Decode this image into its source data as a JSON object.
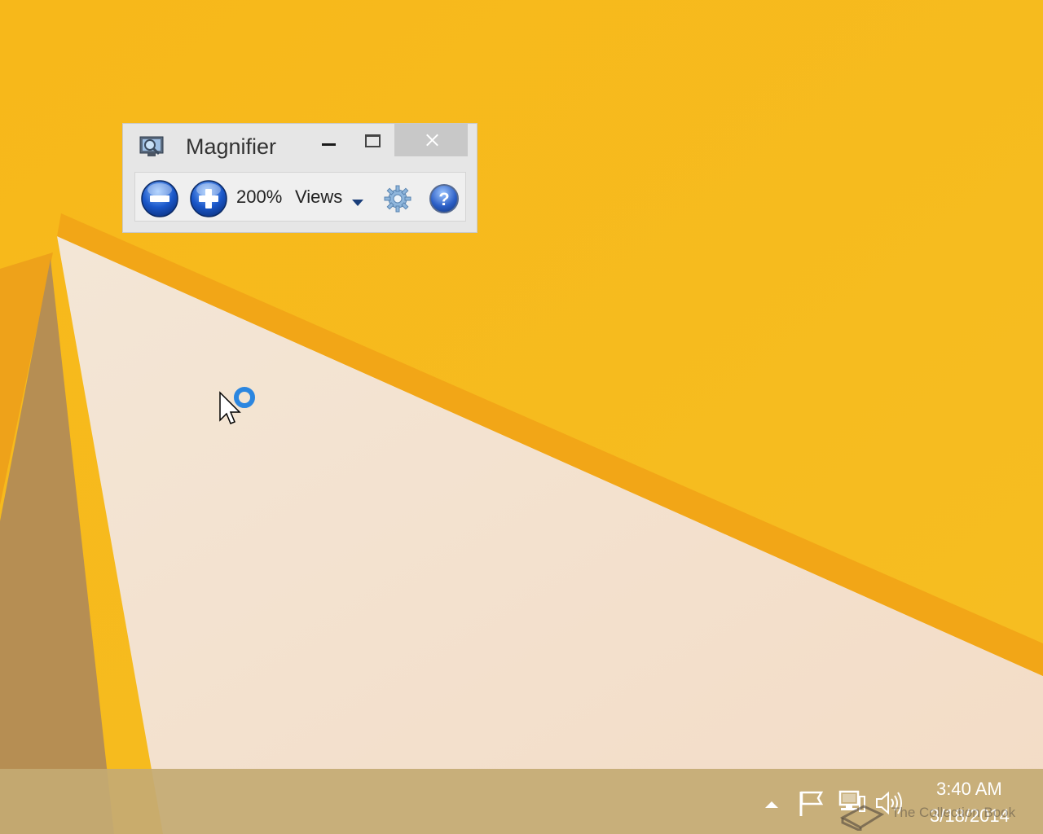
{
  "magnifier": {
    "title": "Magnifier",
    "zoom_level": "200%",
    "views_label": "Views",
    "icons": {
      "app": "magnifier-app-icon",
      "minimize": "minimize-icon",
      "maximize": "maximize-icon",
      "close": "close-icon",
      "zoom_out": "zoom-out-icon",
      "zoom_in": "zoom-in-icon",
      "views_dropdown": "chevron-down-icon",
      "options": "gear-icon",
      "help": "help-icon"
    }
  },
  "taskbar": {
    "time": "3:40 AM",
    "date": "3/18/2014",
    "tray_icons": [
      "show-hidden-icons-arrow",
      "action-center-flag-icon",
      "network-icon",
      "volume-icon"
    ]
  },
  "watermark": "The Collection Book",
  "colors": {
    "wallpaper_yellow": "#f6bb1c",
    "wallpaper_cream": "#f1e0c8",
    "taskbar": "#c4aa73",
    "window_bg": "#e6e6e6",
    "close_button": "#c8c8c8"
  }
}
